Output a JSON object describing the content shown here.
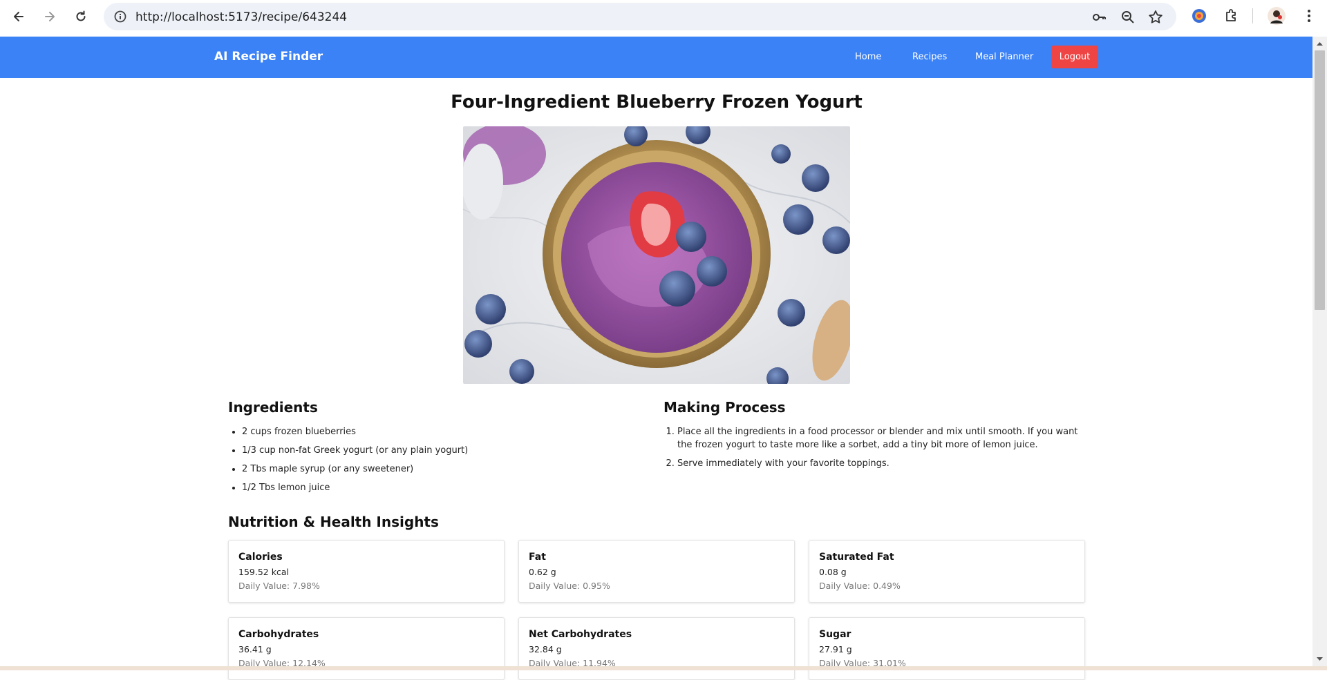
{
  "browser": {
    "url": "http://localhost:5173/recipe/643244"
  },
  "navbar": {
    "brand": "AI Recipe Finder",
    "links": [
      {
        "label": "Home"
      },
      {
        "label": "Recipes"
      },
      {
        "label": "Meal Planner"
      }
    ],
    "logout_label": "Logout"
  },
  "recipe": {
    "title": "Four-Ingredient Blueberry Frozen Yogurt",
    "ingredients_heading": "Ingredients",
    "ingredients": [
      "2 cups frozen blueberries",
      "1/3 cup non-fat Greek yogurt (or any plain yogurt)",
      "2 Tbs maple syrup (or any sweetener)",
      "1/2 Tbs lemon juice"
    ],
    "process_heading": "Making Process",
    "steps": [
      "Place all the ingredients in a food processor or blender and mix until smooth. If you want the frozen yogurt to taste more like a sorbet, add a tiny bit more of lemon juice.",
      "Serve immediately with your favorite toppings."
    ]
  },
  "nutrition": {
    "heading": "Nutrition & Health Insights",
    "items": [
      {
        "name": "Calories",
        "amount": "159.52 kcal",
        "daily": "Daily Value: 7.98%"
      },
      {
        "name": "Fat",
        "amount": "0.62 g",
        "daily": "Daily Value: 0.95%"
      },
      {
        "name": "Saturated Fat",
        "amount": "0.08 g",
        "daily": "Daily Value: 0.49%"
      },
      {
        "name": "Carbohydrates",
        "amount": "36.41 g",
        "daily": "Daily Value: 12.14%"
      },
      {
        "name": "Net Carbohydrates",
        "amount": "32.84 g",
        "daily": "Daily Value: 11.94%"
      },
      {
        "name": "Sugar",
        "amount": "27.91 g",
        "daily": "Daily Value: 31.01%"
      }
    ]
  },
  "colors": {
    "navbar": "#3b82f6",
    "logout": "#ef4444"
  },
  "icons": {
    "back": "arrow-left-icon",
    "forward": "arrow-right-icon",
    "reload": "reload-icon",
    "site_info": "info-icon",
    "password": "key-icon",
    "zoom": "zoom-icon",
    "bookmark": "star-icon",
    "extension": "extension-icon",
    "extensions_menu": "puzzle-icon",
    "profile": "avatar",
    "menu": "kebab-menu-icon"
  }
}
